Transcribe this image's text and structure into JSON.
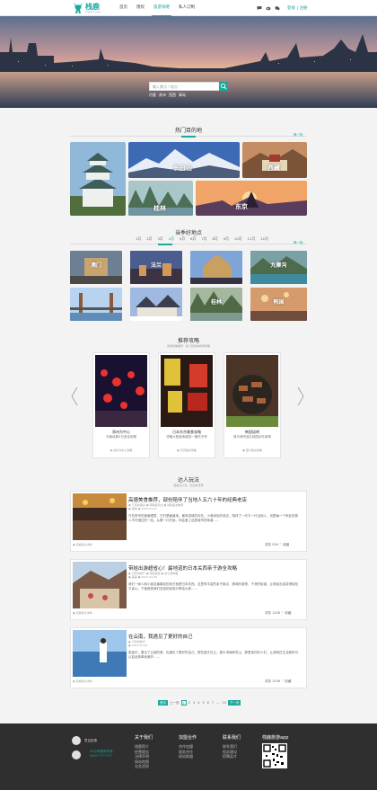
{
  "header": {
    "logo_text": "栈鹿",
    "logo_url": "zhanlu.com",
    "nav": [
      "首页",
      "馈权",
      "旅游攻略",
      "私人订制"
    ],
    "nav_active": 2,
    "login": "登录",
    "divider": "|",
    "register": "注册"
  },
  "banner": {
    "search_placeholder": "输入景点 / 地点",
    "tags": [
      "丹麦",
      "苏州",
      "西西",
      "青岛"
    ]
  },
  "hot": {
    "title": "热门目的地",
    "more": "换一批",
    "tiles": [
      "",
      "长白山",
      "西藏",
      "桂林",
      "东京"
    ]
  },
  "season": {
    "title": "当季好地点",
    "more": "换一批",
    "months": [
      "1月",
      "2月",
      "3月",
      "4月",
      "5月",
      "6月",
      "7月",
      "8月",
      "9月",
      "10月",
      "11月",
      "12月"
    ],
    "active_month": 3,
    "cards": [
      "澳门",
      "法兰",
      "",
      "九寨沟",
      "",
      "",
      "桂林",
      "韩国"
    ]
  },
  "guides": {
    "title": "推荐攻略",
    "subtitle": "旅游攻略推荐 · 热门目的地旅游攻略",
    "cards": [
      {
        "title": "郑州为中心",
        "desc": "河南经典5日游全攻略",
        "meta": "▣ 郑州为中心攻略"
      },
      {
        "title": "日本东京美食攻略",
        "desc": "领略大阪美食盛宴一路吃不停",
        "meta": "▣ 东京美食攻略"
      },
      {
        "title": "韩国烧烤",
        "desc": "首尔烤肉巡礼韩国必吃清单",
        "meta": "▣ 首尔美食攻略"
      }
    ]
  },
  "play": {
    "title": "达人玩法",
    "subtitle": "跟着达人玩，玩出新花样",
    "posts": [
      {
        "title": "高德美食推荐，部份陪伴了当地人五六十年的经典老店",
        "meta1": "▣ 万年的美食 ▣ 阿联族玩法 ▣ 特色美食推荐",
        "meta2": "▣ 丽君 ▣ 2017-01-07",
        "body": "只在夜市的食客眼里，它们是最道地、最有滋味的存在。小巷深处的老店，陪伴了一代又一代当地人，也是每一个来此的旅人不可错过的一站。从第一口开始，你会爱上这座城市的味道……",
        "tag": "▣ 查看原文详情",
        "stats": "浏览 526   ♡ 收藏"
      },
      {
        "title": "带娃出游超省心！最地道的日本关西亲子游全攻略",
        "meta1": "▣ 万年的旅行 ▣ 带娃旅游 ▣ 亲子游攻略",
        "meta2": "▣ 美美 ▣ 2017-01-05",
        "body": "我们一家人和小朋友最喜欢的地方就是日本关西。这里有丰富的亲子景点，美味的食物，干净的街道，让带娃出游变得轻松又省心。下面就把我们总结的经验分享给大家……",
        "tag": "▣ 查看原文详情",
        "stats": "浏览 1426   ♡ 收藏"
      },
      {
        "title": "在云南，我遇见了更好的自己",
        "meta1": "▣ 万年的旅行",
        "meta2": "▣ 2017-01-04",
        "body": "旅途中，看见了云南的美，也遇见了更好的自己。那些蓝天白云，那片洱海和苍山，那里纯朴的人们，让我明白生活原来可以如此简单而美好……",
        "tag": "▣ 查看原文详情",
        "stats": "浏览 1436   ♡ 收藏"
      }
    ]
  },
  "pager": {
    "first": "首页",
    "prev": "上一页",
    "pages": [
      "1",
      "2",
      "3",
      "4",
      "5",
      "6",
      "7",
      "..."
    ],
    "last": "10",
    "next": "下一页",
    "current": 0
  },
  "footer": {
    "contact_label": "意见反馈",
    "phone_label": "24小时服务热线",
    "phone": "4007-777-777",
    "cols": [
      {
        "title": "关于我们",
        "items": [
          "栈鹿简介",
          "经营理念",
          "法律声明",
          "网站地图",
          "业务资质"
        ]
      },
      {
        "title": "加盟合作",
        "items": [
          "合作加盟",
          "商务合作",
          "网站联盟"
        ]
      },
      {
        "title": "联系我们",
        "items": [
          "联系我们",
          "投诉建议",
          "招聘英才"
        ]
      }
    ],
    "app_title": "栈鹿旅游app"
  },
  "colors": {
    "accent": "#1aa99b",
    "footer": "#2f2f2f"
  }
}
